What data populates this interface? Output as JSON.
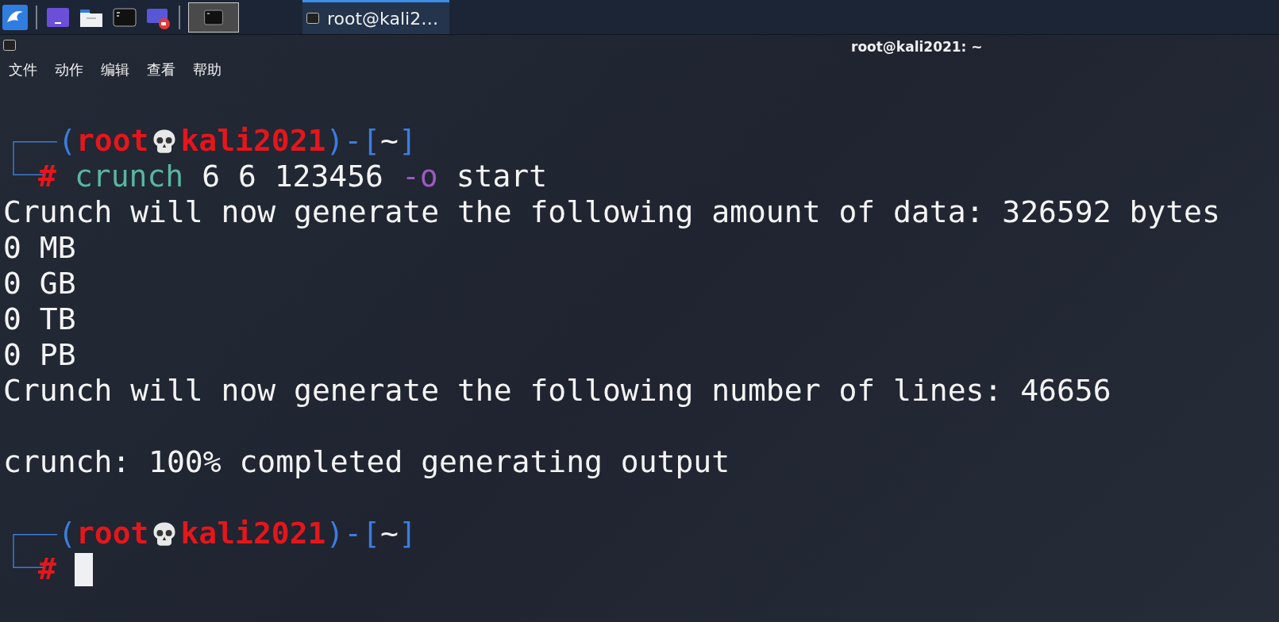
{
  "taskbar": {
    "window_button": {
      "title": "root@kali2…",
      "selected": true
    }
  },
  "window": {
    "title": "root@kali2021: ~"
  },
  "menu": [
    {
      "label": "文件"
    },
    {
      "label": "动作"
    },
    {
      "label": "编辑"
    },
    {
      "label": "查看"
    },
    {
      "label": "帮助"
    }
  ],
  "terminal": {
    "lines": [
      {
        "kind": "prompt",
        "open": "(",
        "user": "root",
        "host": "kali2021",
        "mid": ")-[",
        "dir": "~",
        "close": "]",
        "symbol": "#",
        "command": [
          {
            "kind": "program",
            "text": "crunch"
          },
          {
            "kind": "arg",
            "text": "6 6 123456"
          },
          {
            "kind": "option",
            "text": "-o"
          },
          {
            "kind": "arg",
            "text": "start"
          }
        ]
      },
      {
        "kind": "output",
        "text": "Crunch will now generate the following amount of data: 326592 bytes"
      },
      {
        "kind": "output",
        "text": "0 MB"
      },
      {
        "kind": "output",
        "text": "0 GB"
      },
      {
        "kind": "output",
        "text": "0 TB"
      },
      {
        "kind": "output",
        "text": "0 PB"
      },
      {
        "kind": "output",
        "text": "Crunch will now generate the following number of lines: 46656"
      },
      {
        "kind": "blank"
      },
      {
        "kind": "output",
        "text": "crunch: 100% completed generating output"
      },
      {
        "kind": "blank"
      },
      {
        "kind": "prompt",
        "open": "(",
        "user": "root",
        "host": "kali2021",
        "mid": ")-[",
        "dir": "~",
        "close": "]",
        "symbol": "#",
        "cursor": true
      }
    ]
  }
}
